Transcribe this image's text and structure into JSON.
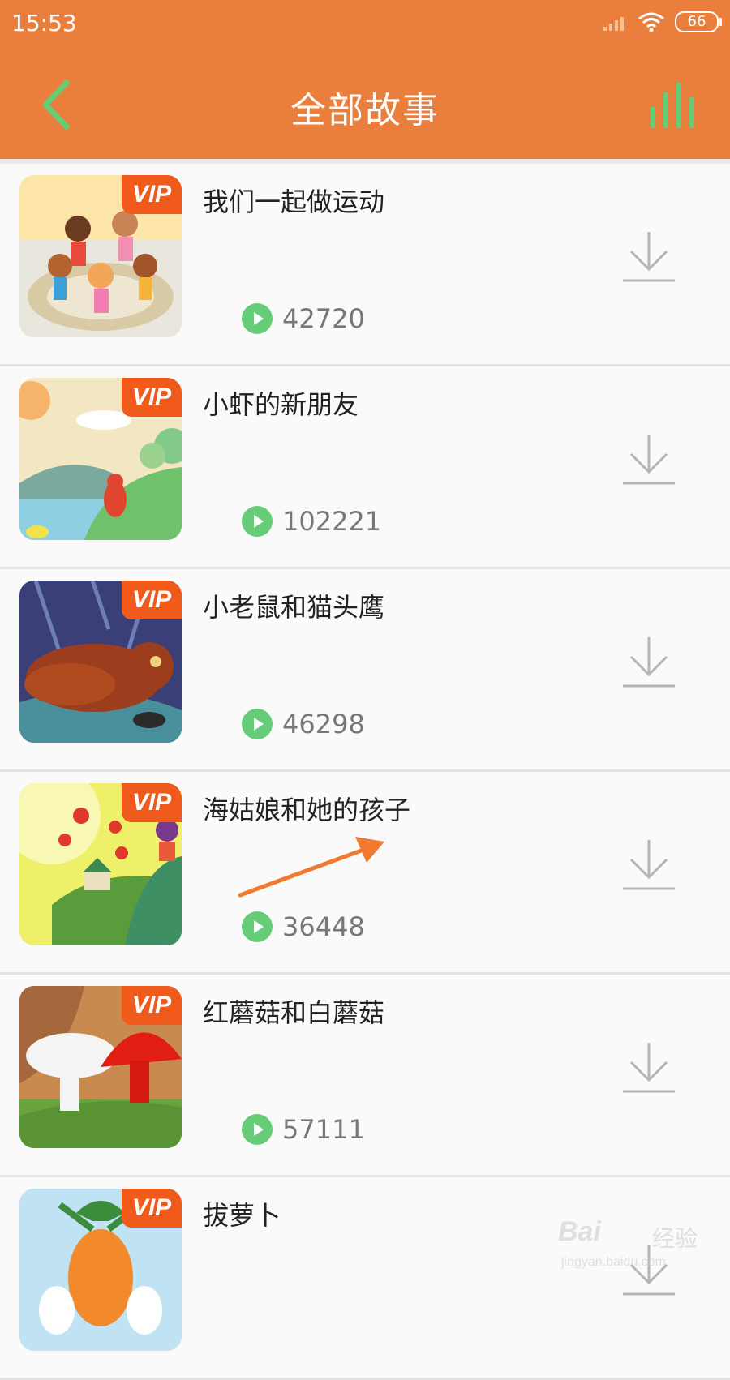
{
  "status_bar": {
    "time": "15:53",
    "battery": "66"
  },
  "header": {
    "title": "全部故事"
  },
  "colors": {
    "primary": "#ea7f3d",
    "accent_green": "#66cc77",
    "vip_badge": "#f05a1a",
    "arrow": "#f07a30"
  },
  "vip_label": "VIP",
  "stories": [
    {
      "title": "我们一起做运动",
      "plays": "42720"
    },
    {
      "title": "小虾的新朋友",
      "plays": "102221"
    },
    {
      "title": "小老鼠和猫头鹰",
      "plays": "46298"
    },
    {
      "title": "海姑娘和她的孩子",
      "plays": "36448"
    },
    {
      "title": "红蘑菇和白蘑菇",
      "plays": "57111"
    },
    {
      "title": "拔萝卜",
      "plays": ""
    }
  ],
  "watermark": {
    "brand": "Bai",
    "brand_cn": "经验",
    "url": "jingyan.baidu.com"
  }
}
